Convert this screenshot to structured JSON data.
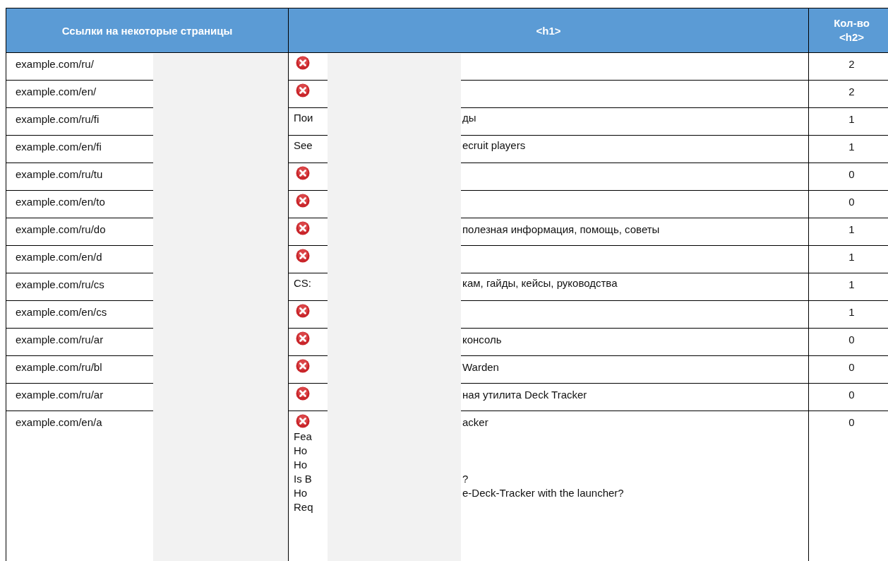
{
  "table": {
    "columns": [
      "Ссылки на некоторые страницы",
      "<h1>",
      "Кол-во <h2>"
    ],
    "rows": [
      {
        "url": "example.com/ru/",
        "h1": [
          {
            "error": true
          }
        ],
        "h2_count": "2"
      },
      {
        "url": "example.com/en/",
        "h1": [
          {
            "error": true
          }
        ],
        "h2_count": "2"
      },
      {
        "url": "example.com/ru/fi",
        "h1": [
          {
            "error": false,
            "start": "Пои",
            "end": "ды"
          }
        ],
        "h2_count": "1"
      },
      {
        "url": "example.com/en/fi",
        "h1": [
          {
            "error": false,
            "start": "See",
            "end": "ecruit players"
          }
        ],
        "h2_count": "1"
      },
      {
        "url": "example.com/ru/tu",
        "h1": [
          {
            "error": true
          }
        ],
        "h2_count": "0"
      },
      {
        "url": "example.com/en/to",
        "h1": [
          {
            "error": true
          }
        ],
        "h2_count": "0"
      },
      {
        "url": "example.com/ru/do",
        "h1": [
          {
            "error": true,
            "end": "полезная информация, помощь, советы"
          }
        ],
        "h2_count": "1"
      },
      {
        "url": "example.com/en/d",
        "h1": [
          {
            "error": true
          }
        ],
        "h2_count": "1"
      },
      {
        "url": "example.com/ru/cs",
        "h1": [
          {
            "error": false,
            "start": "CS:",
            "end": "кам, гайды, кейсы, руководства"
          }
        ],
        "h2_count": "1"
      },
      {
        "url": "example.com/en/cs",
        "h1": [
          {
            "error": true
          }
        ],
        "h2_count": "1"
      },
      {
        "url": "example.com/ru/ar",
        "h1": [
          {
            "error": true,
            "end": "консоль"
          }
        ],
        "h2_count": "0"
      },
      {
        "url": "example.com/ru/bl",
        "h1": [
          {
            "error": true,
            "end": "Warden"
          }
        ],
        "h2_count": "0"
      },
      {
        "url": "example.com/ru/ar",
        "h1": [
          {
            "error": true,
            "end": "ная утилита Deck Tracker"
          }
        ],
        "h2_count": "0"
      },
      {
        "url": "example.com/en/a",
        "h1": [
          {
            "error": true,
            "end": "acker"
          },
          {
            "error": false,
            "start": "Fea"
          },
          {
            "error": false,
            "start": "Ho"
          },
          {
            "error": false,
            "start": "Ho"
          },
          {
            "error": false,
            "start": "Is B",
            "end": "?"
          },
          {
            "error": false,
            "start": "Ho",
            "end": "e-Deck-Tracker with the launcher?"
          },
          {
            "error": false,
            "start": "Req"
          }
        ],
        "h2_count": "0"
      }
    ]
  }
}
